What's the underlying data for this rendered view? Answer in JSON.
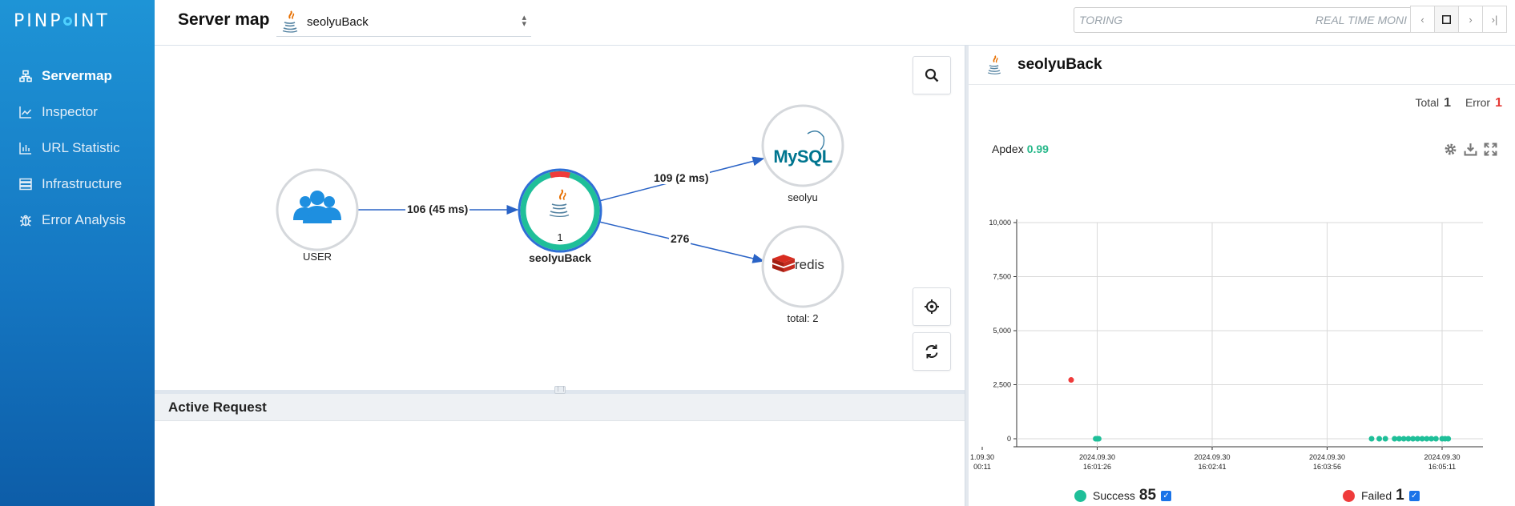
{
  "app": {
    "logo": "PINPOINT"
  },
  "sidebar": {
    "items": [
      {
        "label": "Servermap",
        "icon": "servermap-icon",
        "active": true
      },
      {
        "label": "Inspector",
        "icon": "inspector-icon"
      },
      {
        "label": "URL Statistic",
        "icon": "url-statistic-icon"
      },
      {
        "label": "Infrastructure",
        "icon": "infrastructure-icon"
      },
      {
        "label": "Error Analysis",
        "icon": "bug-icon"
      }
    ]
  },
  "header": {
    "title": "Server map",
    "app_select": {
      "value": "seolyuBack",
      "icon": "java-icon"
    },
    "realtime": {
      "text_left": "TORING",
      "text_right": "REAL TIME MONI"
    },
    "nav_buttons": [
      "prev-icon",
      "stop-icon",
      "next-icon",
      "last-icon"
    ]
  },
  "servermap": {
    "nodes": {
      "user": {
        "label": "USER",
        "icon": "users-icon"
      },
      "app": {
        "label": "seolyuBack",
        "count": "1",
        "icon": "java-icon"
      },
      "mysql": {
        "label": "seolyu",
        "logo": "MySQL"
      },
      "redis": {
        "label": "total: 2",
        "logo": "redis"
      }
    },
    "edges": {
      "user_app": "106 (45 ms)",
      "app_mysql": "109 (2 ms)",
      "app_redis": "276"
    },
    "tools": [
      "search-icon",
      "locate-icon",
      "refresh-icon"
    ]
  },
  "active_request": {
    "title": "Active Request"
  },
  "panel": {
    "app_name": "seolyuBack",
    "total_label": "Total",
    "total_value": "1",
    "error_label": "Error",
    "error_value": "1",
    "apdex_label": "Apdex",
    "apdex_value": "0.99",
    "colors": {
      "success": "#1fbf99",
      "failed": "#ef3b3b",
      "apdex": "#27b88a"
    }
  },
  "chart_data": {
    "type": "scatter",
    "ylim": [
      0,
      10000
    ],
    "y_ticks": [
      "10,000",
      "7,500",
      "5,000",
      "2,500",
      "0"
    ],
    "x_ticks": [
      {
        "date": "1.09.30",
        "time": "00:11"
      },
      {
        "date": "2024.09.30",
        "time": "16:01:26"
      },
      {
        "date": "2024.09.30",
        "time": "16:02:41"
      },
      {
        "date": "2024.09.30",
        "time": "16:03:56"
      },
      {
        "date": "2024.09.30",
        "time": "16:05:11"
      }
    ],
    "grid": true,
    "series": [
      {
        "name": "Success",
        "count": "85",
        "color": "#1fbf99",
        "points": [
          {
            "x": "16:01:25",
            "y": 0
          },
          {
            "x": "16:01:26",
            "y": 0
          },
          {
            "x": "16:01:27",
            "y": 0
          },
          {
            "x": "16:04:25",
            "y": 0
          },
          {
            "x": "16:04:30",
            "y": 0
          },
          {
            "x": "16:04:34",
            "y": 0
          },
          {
            "x": "16:04:40",
            "y": 0
          },
          {
            "x": "16:04:43",
            "y": 0
          },
          {
            "x": "16:04:46",
            "y": 0
          },
          {
            "x": "16:04:49",
            "y": 0
          },
          {
            "x": "16:04:52",
            "y": 0
          },
          {
            "x": "16:04:55",
            "y": 0
          },
          {
            "x": "16:04:58",
            "y": 0
          },
          {
            "x": "16:05:01",
            "y": 0
          },
          {
            "x": "16:05:04",
            "y": 0
          },
          {
            "x": "16:05:07",
            "y": 0
          },
          {
            "x": "16:05:11",
            "y": 0
          },
          {
            "x": "16:05:13",
            "y": 0
          },
          {
            "x": "16:05:15",
            "y": 0
          }
        ]
      },
      {
        "name": "Failed",
        "count": "1",
        "color": "#ef3b3b",
        "points": [
          {
            "x": "16:01:09",
            "y": 2720
          }
        ]
      }
    ]
  }
}
